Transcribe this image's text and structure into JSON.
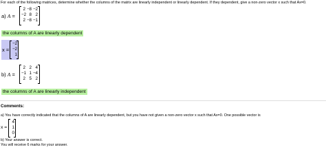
{
  "question": {
    "instructions": "For each of the following matrices, determine whether the columns of the matrix are linearly independent or linearly dependent. If they dependent, give a non-zero vector x such that Ax=0."
  },
  "part_a": {
    "label": "a)",
    "matrix_name": "A",
    "equals": "=",
    "matrix": [
      [
        "2",
        "−8",
        "−2"
      ],
      [
        "−2",
        "8",
        "2"
      ],
      [
        "2",
        "−8",
        "−1"
      ]
    ],
    "answer": "the columns of A are linearly dependent",
    "vector_label": "x =",
    "vector": [
      "−2",
      "−2",
      "1"
    ]
  },
  "part_b": {
    "label": "b)",
    "matrix_name": "A",
    "equals": "=",
    "matrix": [
      [
        "2",
        "2",
        "4"
      ],
      [
        "−1",
        "1",
        "−4"
      ],
      [
        "2",
        "5",
        "2"
      ]
    ],
    "answer": "the columns of A are linearly independent"
  },
  "comments": {
    "heading": "Comments:",
    "line_a": "a) You have correctly indicated that the columns of A are linearly dependent, but you have not given a non-zero vector x such that Ax=0. One possible vector is",
    "vector_label": "x =",
    "vector": [
      "4",
      "1",
      "0"
    ],
    "line_b": "b) Your answer is correct.",
    "line_marks": "You will receive 6 marks for your answer."
  },
  "colors": {
    "answer_highlight": "#b8f0a0",
    "vector_highlight": "#c9c9f4"
  }
}
